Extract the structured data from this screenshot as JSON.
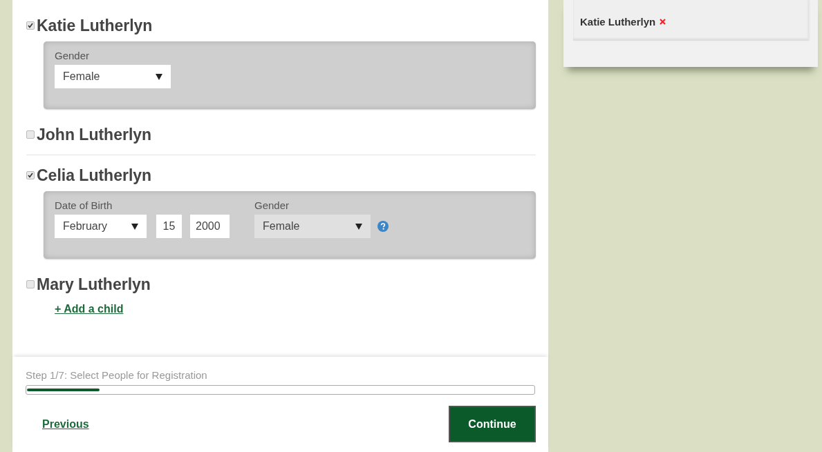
{
  "people": [
    {
      "name": "Katie Lutherlyn",
      "checked": true,
      "divider_after": false,
      "fields": [
        {
          "kind": "select",
          "label": "Gender",
          "value": "Female",
          "disabled": false
        }
      ]
    },
    {
      "name": "John Lutherlyn",
      "checked": false,
      "divider_after": true
    },
    {
      "name": "Celia Lutherlyn",
      "checked": true,
      "divider_after": false,
      "fields": [
        {
          "kind": "date",
          "label": "Date of Birth",
          "month": "February",
          "day": "15",
          "year": "2000"
        },
        {
          "kind": "select",
          "label": "Gender",
          "value": "Female",
          "disabled": true,
          "help": true
        }
      ]
    },
    {
      "name": "Mary Lutherlyn",
      "checked": false,
      "divider_after": false
    }
  ],
  "add_link": "+ Add a child",
  "progress": {
    "label": "Step 1/7: Select People for Registration",
    "level": 0.143
  },
  "buttons": {
    "previous": "Previous",
    "continue": "Continue"
  },
  "selected_people": [
    {
      "name": "Katie Lutherlyn"
    }
  ]
}
